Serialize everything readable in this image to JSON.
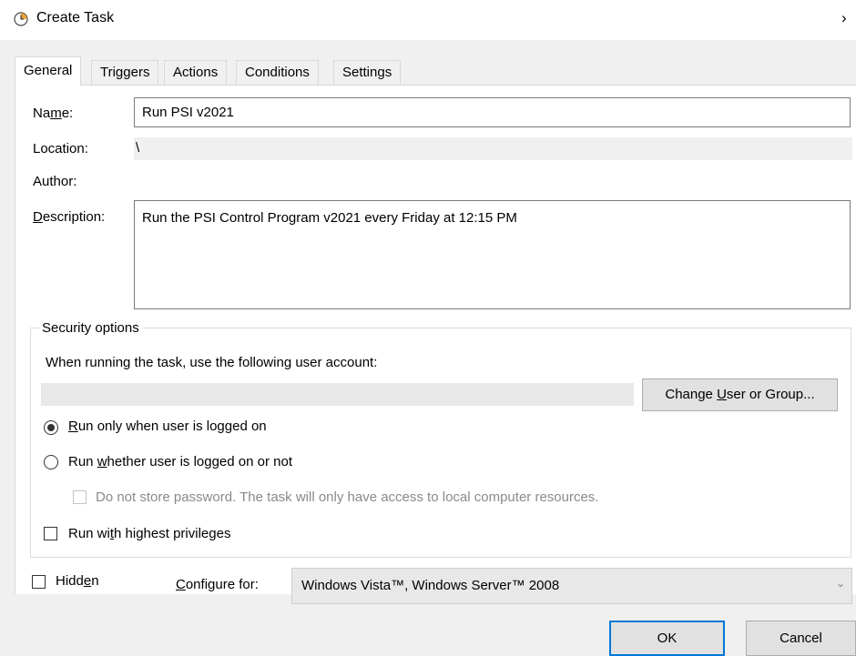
{
  "window": {
    "title": "Create Task",
    "icon": "clock-icon",
    "close_glyph": "›"
  },
  "tabs": [
    {
      "label": "General",
      "active": true
    },
    {
      "label": "Triggers"
    },
    {
      "label": "Actions"
    },
    {
      "label": "Conditions"
    },
    {
      "label": "Settings"
    }
  ],
  "general": {
    "name_label_pre": "Na",
    "name_label_u": "m",
    "name_label_post": "e:",
    "name_value": "Run PSI v2021",
    "location_label": "Location:",
    "location_value": "\\",
    "author_label": "Author:",
    "author_value": "",
    "description_label_u": "D",
    "description_label_post": "escription:",
    "description_value": "Run the PSI Control Program v2021 every Friday at 12:15 PM"
  },
  "security": {
    "group_title": "Security options",
    "account_prompt": "When running the task, use the following user account:",
    "account_value": "",
    "change_button_pre": "Change ",
    "change_button_u": "U",
    "change_button_post": "ser or Group...",
    "radio_logged_on": {
      "u": "R",
      "rest": "un only when user is logged on",
      "checked": true
    },
    "radio_whether": {
      "pre": "Run ",
      "u": "w",
      "rest": "hether user is logged on or not",
      "checked": false
    },
    "no_store_password": {
      "label": "Do not store password.  The task will only have access to local computer resources.",
      "checked": false,
      "disabled": true
    },
    "highest_privileges": {
      "pre": "Run wi",
      "u": "t",
      "rest": "h highest privileges",
      "checked": false
    }
  },
  "footer": {
    "hidden": {
      "pre": "Hidd",
      "u": "e",
      "rest": "n",
      "checked": false
    },
    "configure_label_u": "C",
    "configure_label_rest": "onfigure for:",
    "configure_value": "Windows Vista™, Windows Server™ 2008",
    "ok_label": "OK",
    "cancel_label": "Cancel"
  }
}
